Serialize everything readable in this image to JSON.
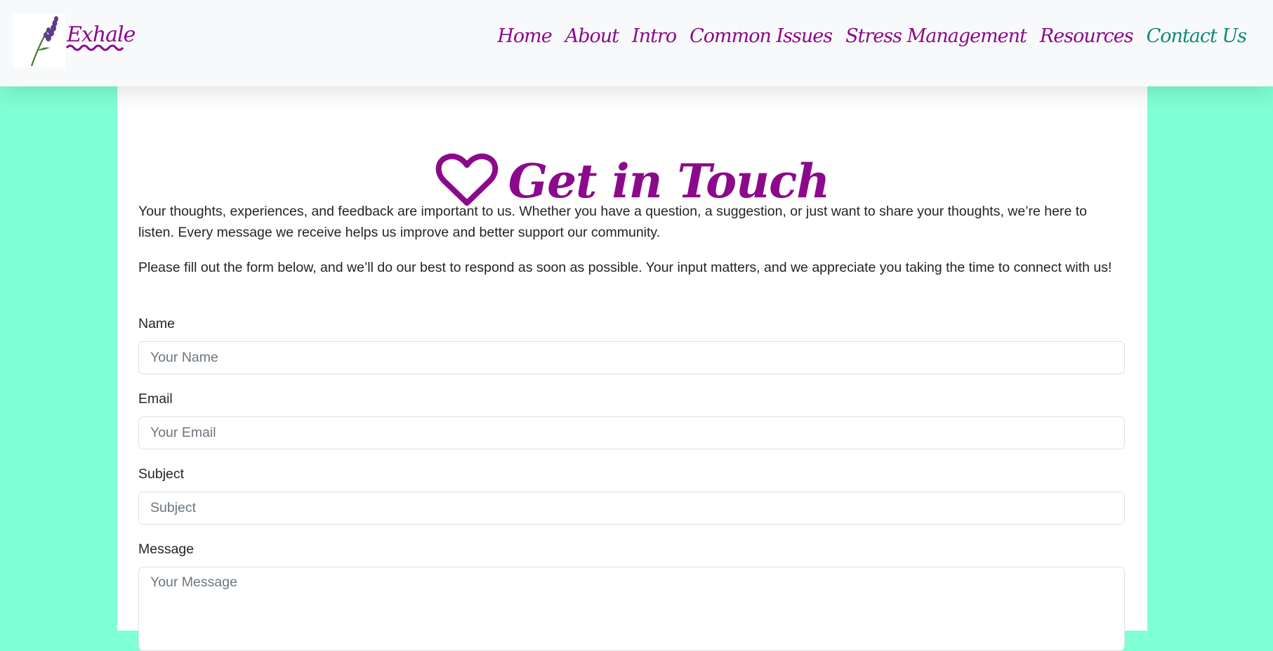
{
  "brand": {
    "name": "Exhale"
  },
  "nav": {
    "items": [
      {
        "label": "Home"
      },
      {
        "label": "About"
      },
      {
        "label": "Intro"
      },
      {
        "label": "Common Issues"
      },
      {
        "label": "Stress Management"
      },
      {
        "label": "Resources"
      },
      {
        "label": "Contact Us"
      }
    ],
    "active_index": 6,
    "color": "#8b0a8c",
    "active_color": "#0f8a7a"
  },
  "contact": {
    "title": "Get in Touch",
    "title_icon": "heart-icon",
    "intro_1": "Your thoughts, experiences, and feedback are important to us. Whether you have a question, a suggestion, or just want to share your thoughts, we’re here to listen. Every message we receive helps us improve and better support our community.",
    "intro_2": "Please fill out the form below, and we’ll do our best to respond as soon as possible. Your input matters, and we appreciate you taking the time to connect with us!",
    "form": {
      "name_label": "Name",
      "name_placeholder": "Your Name",
      "email_label": "Email",
      "email_placeholder": "Your Email",
      "subject_label": "Subject",
      "subject_placeholder": "Subject",
      "message_label": "Message",
      "message_placeholder": "Your Message"
    }
  },
  "colors": {
    "page_background": "#7fffd4",
    "accent": "#8b0a8c"
  }
}
